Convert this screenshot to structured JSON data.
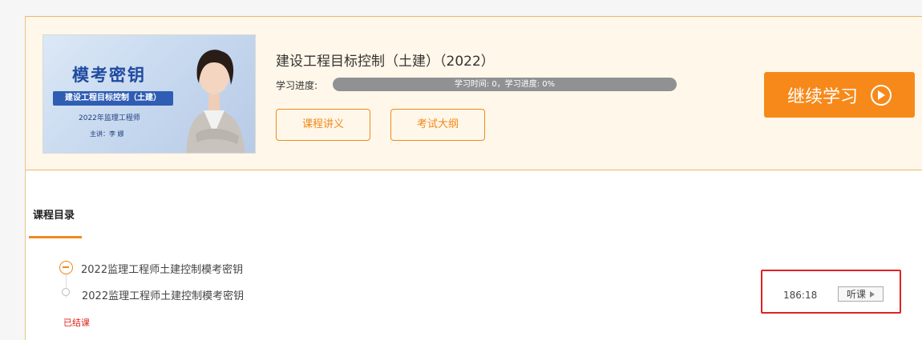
{
  "course": {
    "cover": {
      "title": "模考密钥",
      "banner": "建设工程目标控制（土建）",
      "subtitle": "2022年监理工程师",
      "teacher": "主讲：李 娜"
    },
    "title": "建设工程目标控制（土建）（2022）",
    "progress_label": "学习进度:",
    "progress_text": "学习时间: 0，学习进度: 0%",
    "progress_fraction": 0,
    "buttons": {
      "handout": "课程讲义",
      "syllabus": "考试大纲",
      "continue": "继续学习"
    }
  },
  "catalog": {
    "tab_label": "课程目录",
    "chapter": {
      "title": "2022监理工程师土建控制模考密钥"
    },
    "lesson": {
      "title": "2022监理工程师土建控制模考密钥",
      "status": "已结课",
      "duration": "186:18",
      "listen_label": "听课"
    }
  },
  "colors": {
    "accent": "#f08a1b",
    "card_bg": "#fff7e9",
    "highlight": "#e02222",
    "status": "#e0221c"
  },
  "icons": {
    "continue": "play-circle-icon",
    "chapter": "minus-circle-icon",
    "lesson": "dot-icon",
    "listen": "play-triangle-icon"
  }
}
